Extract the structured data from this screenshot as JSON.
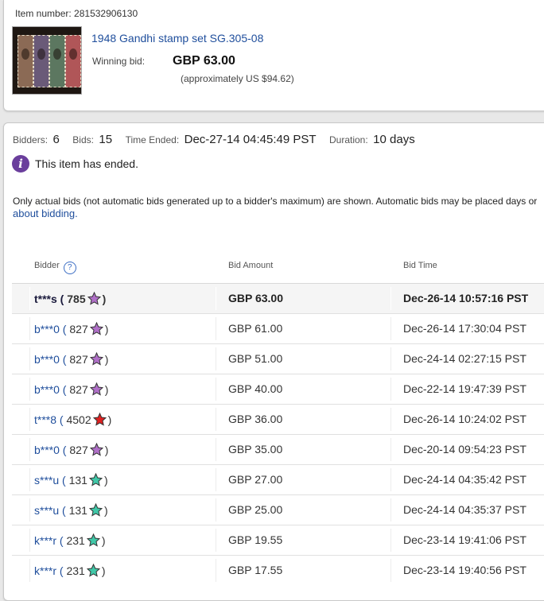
{
  "item": {
    "item_number_label": "Item number:",
    "item_number": "281532906130",
    "title": "1948 Gandhi stamp set SG.305-08",
    "winning_bid_label": "Winning bid:",
    "winning_bid": "GBP 63.00",
    "approx": "(approximately US $94.62)"
  },
  "stats": {
    "bidders_label": "Bidders:",
    "bidders": "6",
    "bids_label": "Bids:",
    "bids": "15",
    "time_ended_label": "Time Ended:",
    "time_ended": "Dec-27-14 04:45:49 PST",
    "duration_label": "Duration:",
    "duration": "10 days"
  },
  "status": {
    "icon": "info-icon",
    "text": "This item has ended."
  },
  "notice": {
    "text": "Only actual bids (not automatic bids generated up to a bidder's maximum) are shown. Automatic bids may be placed days or",
    "link": "about bidding."
  },
  "columns": {
    "bidder": "Bidder",
    "amount": "Bid Amount",
    "time": "Bid Time",
    "help_icon": "question-icon"
  },
  "star_colors": {
    "purple": "#b070c8",
    "red": "#e02020",
    "teal": "#40c8a8"
  },
  "rows": [
    {
      "bidder": "t***s",
      "score": "785",
      "star": "purple",
      "amount": "GBP 63.00",
      "time": "Dec-26-14 10:57:16 PST"
    },
    {
      "bidder": "b***0",
      "score": "827",
      "star": "purple",
      "amount": "GBP 61.00",
      "time": "Dec-26-14 17:30:04 PST"
    },
    {
      "bidder": "b***0",
      "score": "827",
      "star": "purple",
      "amount": "GBP 51.00",
      "time": "Dec-24-14 02:27:15 PST"
    },
    {
      "bidder": "b***0",
      "score": "827",
      "star": "purple",
      "amount": "GBP 40.00",
      "time": "Dec-22-14 19:47:39 PST"
    },
    {
      "bidder": "t***8",
      "score": "4502",
      "star": "red",
      "amount": "GBP 36.00",
      "time": "Dec-26-14 10:24:02 PST"
    },
    {
      "bidder": "b***0",
      "score": "827",
      "star": "purple",
      "amount": "GBP 35.00",
      "time": "Dec-20-14 09:54:23 PST"
    },
    {
      "bidder": "s***u",
      "score": "131",
      "star": "teal",
      "amount": "GBP 27.00",
      "time": "Dec-24-14 04:35:42 PST"
    },
    {
      "bidder": "s***u",
      "score": "131",
      "star": "teal",
      "amount": "GBP 25.00",
      "time": "Dec-24-14 04:35:37 PST"
    },
    {
      "bidder": "k***r",
      "score": "231",
      "star": "teal",
      "amount": "GBP 19.55",
      "time": "Dec-23-14 19:41:06 PST"
    },
    {
      "bidder": "k***r",
      "score": "231",
      "star": "teal",
      "amount": "GBP 17.55",
      "time": "Dec-23-14 19:40:56 PST"
    }
  ]
}
